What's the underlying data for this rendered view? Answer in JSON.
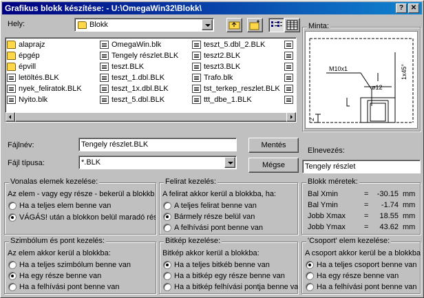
{
  "window": {
    "title": "Grafikus blokk készítése: - U:\\OmegaWin32\\Blokk\\",
    "help_btn": "?",
    "close_btn": "✕"
  },
  "hely": {
    "label": "Hely:",
    "value": "Blokk"
  },
  "files": {
    "col1": [
      {
        "name": "alaprajz",
        "type": "folder"
      },
      {
        "name": "épgép",
        "type": "folder"
      },
      {
        "name": "épvill",
        "type": "folder"
      },
      {
        "name": "letöltés.BLK",
        "type": "file"
      },
      {
        "name": "nyek_feliratok.BLK",
        "type": "file"
      },
      {
        "name": "Nyito.blk",
        "type": "file"
      }
    ],
    "col2": [
      {
        "name": "OmegaWin.blk",
        "type": "file"
      },
      {
        "name": "Tengely részlet.BLK",
        "type": "file"
      },
      {
        "name": "teszt.BLK",
        "type": "file"
      },
      {
        "name": "teszt_1.dbl.BLK",
        "type": "file"
      },
      {
        "name": "teszt_1x.dbl.BLK",
        "type": "file"
      },
      {
        "name": "teszt_5.dbl.BLK",
        "type": "file"
      }
    ],
    "col3": [
      {
        "name": "teszt_5.dbl_2.BLK",
        "type": "file"
      },
      {
        "name": "teszt2.BLK",
        "type": "file"
      },
      {
        "name": "teszt3.BLK",
        "type": "file"
      },
      {
        "name": "Trafo.blk",
        "type": "file"
      },
      {
        "name": "tst_terkep_reszlet.BLK",
        "type": "file"
      },
      {
        "name": "ttt_dbe_1.BLK",
        "type": "file"
      }
    ]
  },
  "minta": {
    "label": "Minta:",
    "dim1": "M10x1",
    "dim2": "1x45°",
    "dim3": "ø12",
    "dim4": "2"
  },
  "fajlnev": {
    "label": "Fájlnév:",
    "value": "Tengely részlet.BLK"
  },
  "fajltipus": {
    "label": "Fájl típusa:",
    "value": "*.BLK"
  },
  "buttons": {
    "save": "Mentés",
    "cancel": "Mégse"
  },
  "elnevezes": {
    "label": "Elnevezés:",
    "value": "Tengely részlet"
  },
  "vonalas": {
    "title": "Vonalas elemek kezelése:",
    "desc": "Az elem - vagy egy része - bekerül a blokkba:",
    "opt1": "Ha a teljes elem benne van",
    "opt2": "VÁGÁS! után a blokkon belül maradó rész"
  },
  "felirat": {
    "title": "Felirat kezelés:",
    "desc": "A felirat akkor kerül a blokkba, ha:",
    "opt1": "A teljes felirat benne van",
    "opt2": "Bármely része belül van",
    "opt3": "A felhívási pont benne van"
  },
  "blokk_meretek": {
    "title": "Blokk méretek:",
    "rows": [
      {
        "label": "Bal Xmin",
        "eq": "=",
        "value": "-30.15",
        "unit": "mm"
      },
      {
        "label": "Bal Ymin",
        "eq": "=",
        "value": "-1.74",
        "unit": "mm"
      },
      {
        "label": "Jobb Xmax",
        "eq": "=",
        "value": "18.55",
        "unit": "mm"
      },
      {
        "label": "Jobb Ymax",
        "eq": "=",
        "value": "43.62",
        "unit": "mm"
      }
    ]
  },
  "szimbolum": {
    "title": "Szimbólum és pont kezelés:",
    "desc": "Az elem akkor kerül a blokkba:",
    "opt1": "Ha a teljes szimbólum benne van",
    "opt2": "Ha egy része benne van",
    "opt3": "Ha a felhívási pont benne van"
  },
  "bitkep": {
    "title": "Bitkép kezelése:",
    "desc": "Bitkép akkor kerül a blokkba:",
    "opt1": "Ha a teljes bitkéb benne van",
    "opt2": "Ha a bitkép egy része benne van",
    "opt3": "Ha a bitkép felhívási pontja benne van"
  },
  "csoport": {
    "title": "'Csoport' elem kezelése:",
    "desc": "A csoport akkor kerül be a blokkba",
    "opt1": "Ha a teljes csoport benne van",
    "opt2": "Ha egy része benne van",
    "opt3": "Ha a felhívási pont benne van"
  }
}
